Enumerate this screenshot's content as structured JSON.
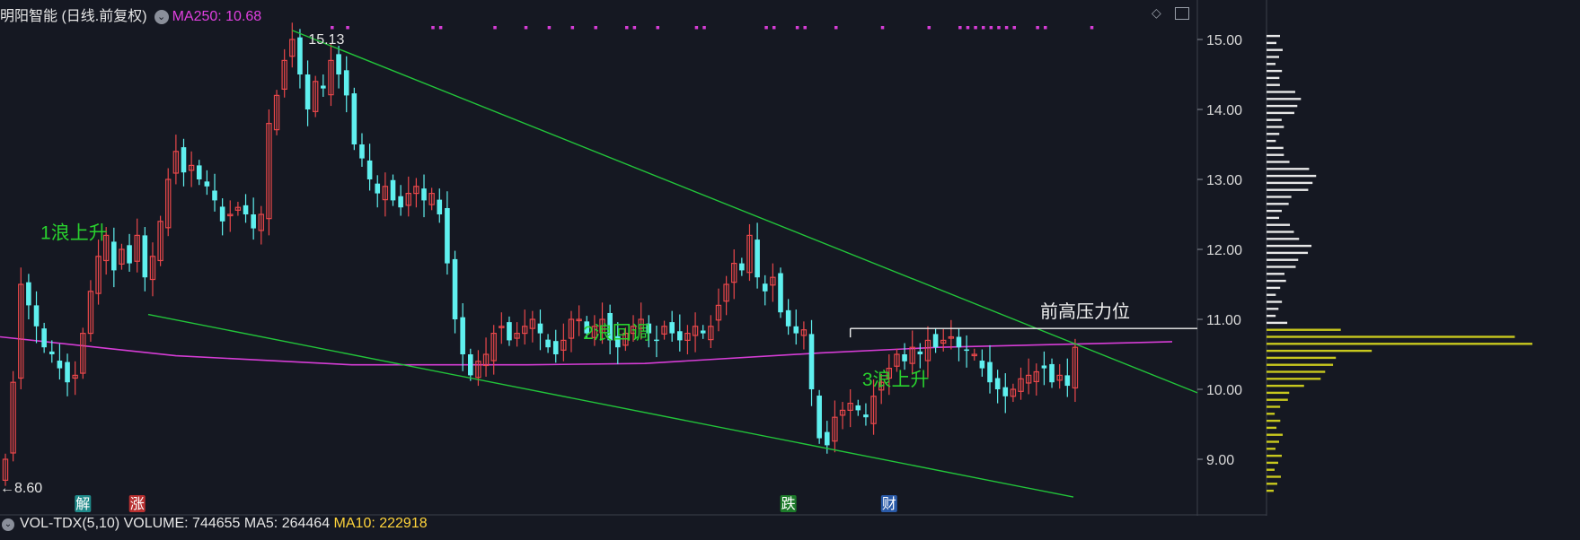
{
  "header": {
    "title": "明阳智能 (日线.前复权)",
    "ma_label": "MA250: 10.68"
  },
  "footer": {
    "indicator": "VOL-TDX(5,10)",
    "volume": "VOLUME: 744655",
    "ma5": "MA5: 264464",
    "ma10": "MA10: 222918"
  },
  "colors": {
    "up": "#e8474a",
    "down": "#5ff0ef",
    "ma250": "#d63dd6",
    "trend": "#22c43a",
    "wave_text": "#29d12e",
    "profile_upper": "#e8e8e8",
    "profile_lower": "#c8c81e",
    "background": "#151822"
  },
  "icons": [
    "chevron-down-icon",
    "diamond-icon",
    "panel-toggle-icon"
  ],
  "chart_data": {
    "type": "candlestick",
    "y_ticks": [
      "15.00",
      "14.00",
      "13.00",
      "12.00",
      "11.00",
      "10.00",
      "9.00"
    ],
    "ylim": [
      8.5,
      15.2
    ],
    "close": [
      9.0,
      10.1,
      11.5,
      11.2,
      10.9,
      10.6,
      10.5,
      10.3,
      10.1,
      10.2,
      10.8,
      11.4,
      11.9,
      12.2,
      11.7,
      12.0,
      11.8,
      12.2,
      11.6,
      11.9,
      12.4,
      13.0,
      13.4,
      13.1,
      13.2,
      13.0,
      12.9,
      12.7,
      12.4,
      12.5,
      12.6,
      12.5,
      12.3,
      12.5,
      13.8,
      14.2,
      14.7,
      15.0,
      14.5,
      14.0,
      14.4,
      14.3,
      14.7,
      14.5,
      14.2,
      13.5,
      13.3,
      13.0,
      12.8,
      12.9,
      12.7,
      12.6,
      12.8,
      12.9,
      12.7,
      12.8,
      12.5,
      11.8,
      11.0,
      10.5,
      10.2,
      10.4,
      10.5,
      10.8,
      10.9,
      10.7,
      10.8,
      10.9,
      11.0,
      10.8,
      10.6,
      10.5,
      10.7,
      11.0,
      11.0,
      10.8,
      10.9,
      11.0,
      10.7,
      10.6,
      10.8,
      10.9,
      11.0,
      10.8,
      10.7,
      10.9,
      10.8,
      10.7,
      10.8,
      10.9,
      10.8,
      10.9,
      11.2,
      11.5,
      11.8,
      11.7,
      12.2,
      11.6,
      11.4,
      11.6,
      11.1,
      10.9,
      10.8,
      10.85,
      10.0,
      9.3,
      9.2,
      9.6,
      9.7,
      9.8,
      9.7,
      9.6,
      9.9,
      10.1,
      10.3,
      10.5,
      10.4,
      10.6,
      10.5,
      10.7,
      10.6,
      10.7,
      10.75,
      10.6,
      10.55,
      10.5,
      10.3,
      10.1,
      10.0,
      9.9,
      10.0,
      10.15,
      10.2,
      10.25,
      10.3,
      10.1,
      10.2,
      10.05,
      10.6
    ],
    "prev_high": 10.87,
    "max_price": 15.13,
    "min_price": 8.6,
    "labels": {
      "max": "15.13",
      "min": "←8.60",
      "wave1": "1浪上升",
      "wave2": "2浪回调",
      "wave3": "3浪上升",
      "resistance": "前高压力位"
    },
    "markers": [
      {
        "text": "解",
        "index": 10,
        "bg": "#1f8a8a"
      },
      {
        "text": "涨",
        "index": 17,
        "bg": "#b83030"
      },
      {
        "text": "跌",
        "index": 101,
        "bg": "#1d7a2a"
      },
      {
        "text": "财",
        "index": 114,
        "bg": "#2a5aa8"
      }
    ],
    "magenta_dot_indices": [
      35,
      37,
      48,
      49,
      56,
      60,
      63,
      66,
      69,
      73,
      74,
      77,
      82,
      83,
      91,
      92,
      95,
      96,
      100,
      106,
      112,
      116,
      117,
      118,
      119,
      120,
      121,
      122,
      123,
      126,
      127,
      133
    ]
  }
}
